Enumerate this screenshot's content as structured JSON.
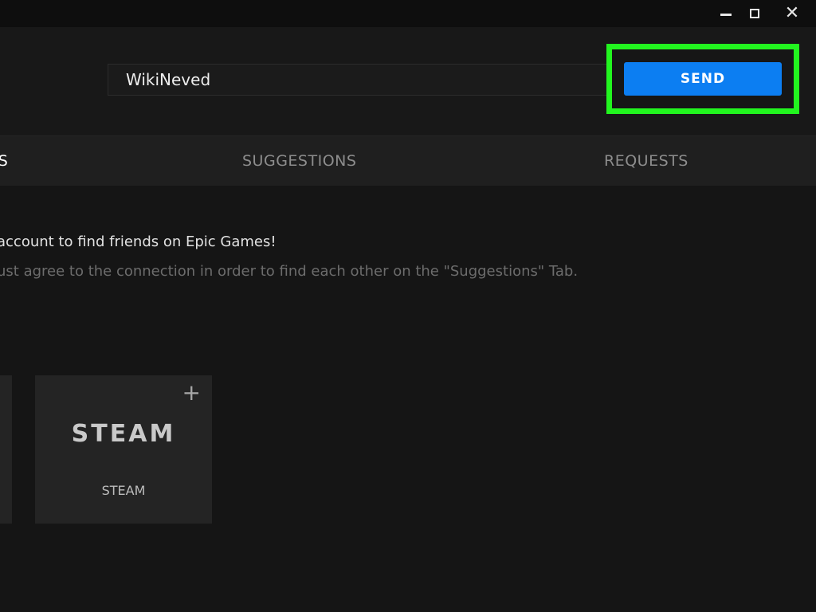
{
  "window": {
    "minimize_icon": "minimize-icon",
    "maximize_icon": "maximize-icon",
    "close_icon": "close-icon",
    "close_glyph": "✕"
  },
  "search": {
    "value": "WikiNeved"
  },
  "send_button": {
    "label": "SEND",
    "color": "#0c7ef2",
    "highlight_color": "#22f51f"
  },
  "tabs": [
    {
      "label": "NS",
      "active": true
    },
    {
      "label": "SUGGESTIONS",
      "active": false
    },
    {
      "label": "REQUESTS",
      "active": false
    }
  ],
  "info": {
    "title": "account to find friends on Epic Games!",
    "subtitle": "ust agree to the connection in order to find each other on the \"Suggestions\" Tab."
  },
  "cards": [
    {
      "logo_text": "STEAM",
      "label": "STEAM",
      "add_icon": "plus-icon",
      "add_glyph": "+"
    }
  ]
}
